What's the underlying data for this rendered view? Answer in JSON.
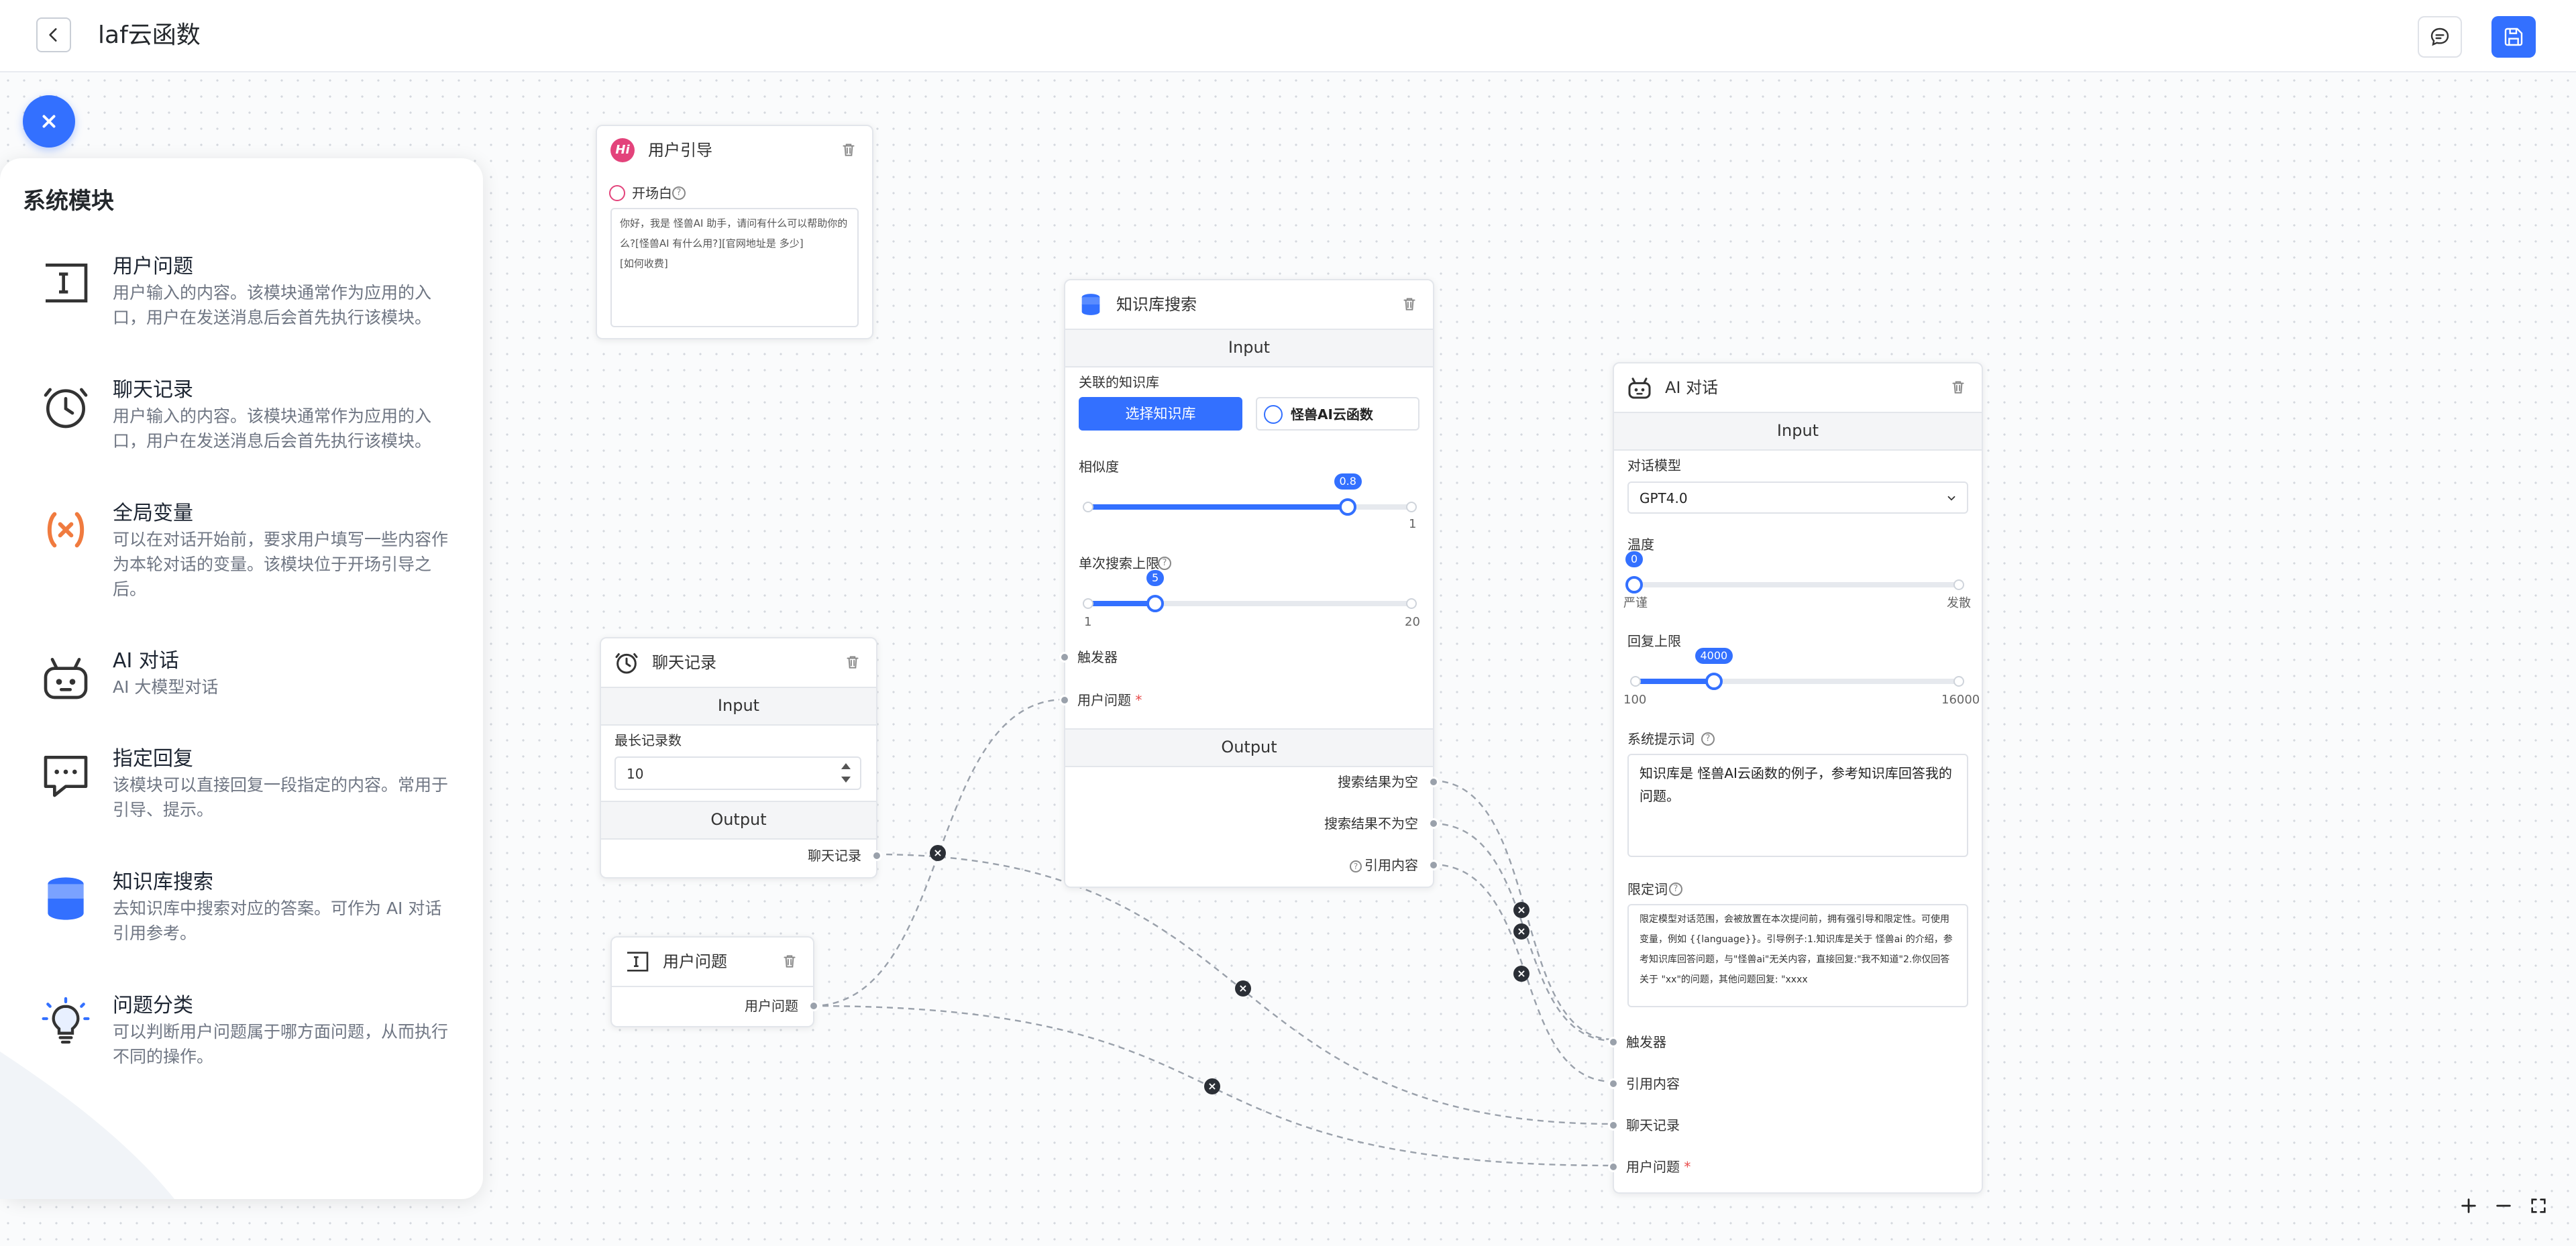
{
  "header": {
    "title": "laf云函数"
  },
  "panel": {
    "title": "系统模块",
    "modules": [
      {
        "name": "用户问题",
        "desc": "用户输入的内容。该模块通常作为应用的入口，用户在发送消息后会首先执行该模块。",
        "icon": "text-cursor-icon"
      },
      {
        "name": "聊天记录",
        "desc": "用户输入的内容。该模块通常作为应用的入口，用户在发送消息后会首先执行该模块。",
        "icon": "clock-icon"
      },
      {
        "name": "全局变量",
        "desc": "可以在对话开始前，要求用户填写一些内容作为本轮对话的变量。该模块位于开场引导之后。",
        "icon": "variable-icon",
        "color": "#f07b3f"
      },
      {
        "name": "AI 对话",
        "desc": "AI 大模型对话",
        "icon": "robot-icon"
      },
      {
        "name": "指定回复",
        "desc": "该模块可以直接回复一段指定的内容。常用于引导、提示。",
        "icon": "chat-bubble-icon"
      },
      {
        "name": "知识库搜索",
        "desc": "去知识库中搜索对应的答案。可作为 AI 对话引用参考。",
        "icon": "database-icon",
        "color": "#3370ff"
      },
      {
        "name": "问题分类",
        "desc": "可以判断用户问题属于哪方面问题，从而执行不同的操作。",
        "icon": "bulb-icon"
      }
    ]
  },
  "user_guide": {
    "title": "用户引导",
    "opening_label": "开场白",
    "opening_text_1": "你好，我是 怪兽AI 助手，请问有什么可以帮助你的么?[怪兽AI 有什么用?][官网地址是 多少]",
    "opening_text_2": "[如何收费]"
  },
  "kb_search": {
    "title": "知识库搜索",
    "input_label": "Input",
    "kb_label": "关联的知识库",
    "select_button": "选择知识库",
    "selected_kb": "怪兽AI云函数",
    "similarity_label": "相似度",
    "similarity_value": "0.8",
    "similarity_fraction": 0.8,
    "similarity_max_label": "1",
    "limit_label": "单次搜索上限",
    "limit_value": "5",
    "limit_fraction": 0.21,
    "limit_min_label": "1",
    "limit_max_label": "20",
    "trigger_label": "触发器",
    "question_label": "用户问题",
    "output_label": "Output",
    "out_empty": "搜索结果为空",
    "out_not_empty": "搜索结果不为空",
    "out_quote": "引用内容"
  },
  "chat_history": {
    "title": "聊天记录",
    "input_label": "Input",
    "max_label": "最长记录数",
    "max_value": "10",
    "output_label": "Output",
    "out_label": "聊天记录"
  },
  "user_question": {
    "title": "用户问题",
    "out_label": "用户问题"
  },
  "ai_chat": {
    "title": "AI 对话",
    "input_label": "Input",
    "model_label": "对话模型",
    "model_value": "GPT4.0",
    "temp_label": "温度",
    "temp_value": "0",
    "temp_fraction": 0.0,
    "temp_min_label": "严谨",
    "temp_max_label": "发散",
    "max_tokens_label": "回复上限",
    "max_tokens_value": "4000",
    "max_tokens_fraction": 0.245,
    "max_tokens_min_label": "100",
    "max_tokens_max_label": "16000",
    "system_prompt_label": "系统提示词",
    "system_prompt_value": "知识库是 怪兽AI云函数的例子，参考知识库回答我的问题。",
    "limit_prompt_label": "限定词",
    "limit_prompt_value": "限定模型对话范围，会被放置在本次提问前，拥有强引导和限定性。可使用变量，例如 {{language}}。引导例子:1.知识库是关于 怪兽ai 的介绍，参考知识库回答问题，与\"怪兽ai\"无关内容，直接回复:\"我不知道\"2.你仅回答关于 \"xx\"的问题，其他问题回复: \"xxxx",
    "in_trigger": "触发器",
    "in_quote": "引用内容",
    "in_history": "聊天记录",
    "in_question": "用户问题"
  }
}
